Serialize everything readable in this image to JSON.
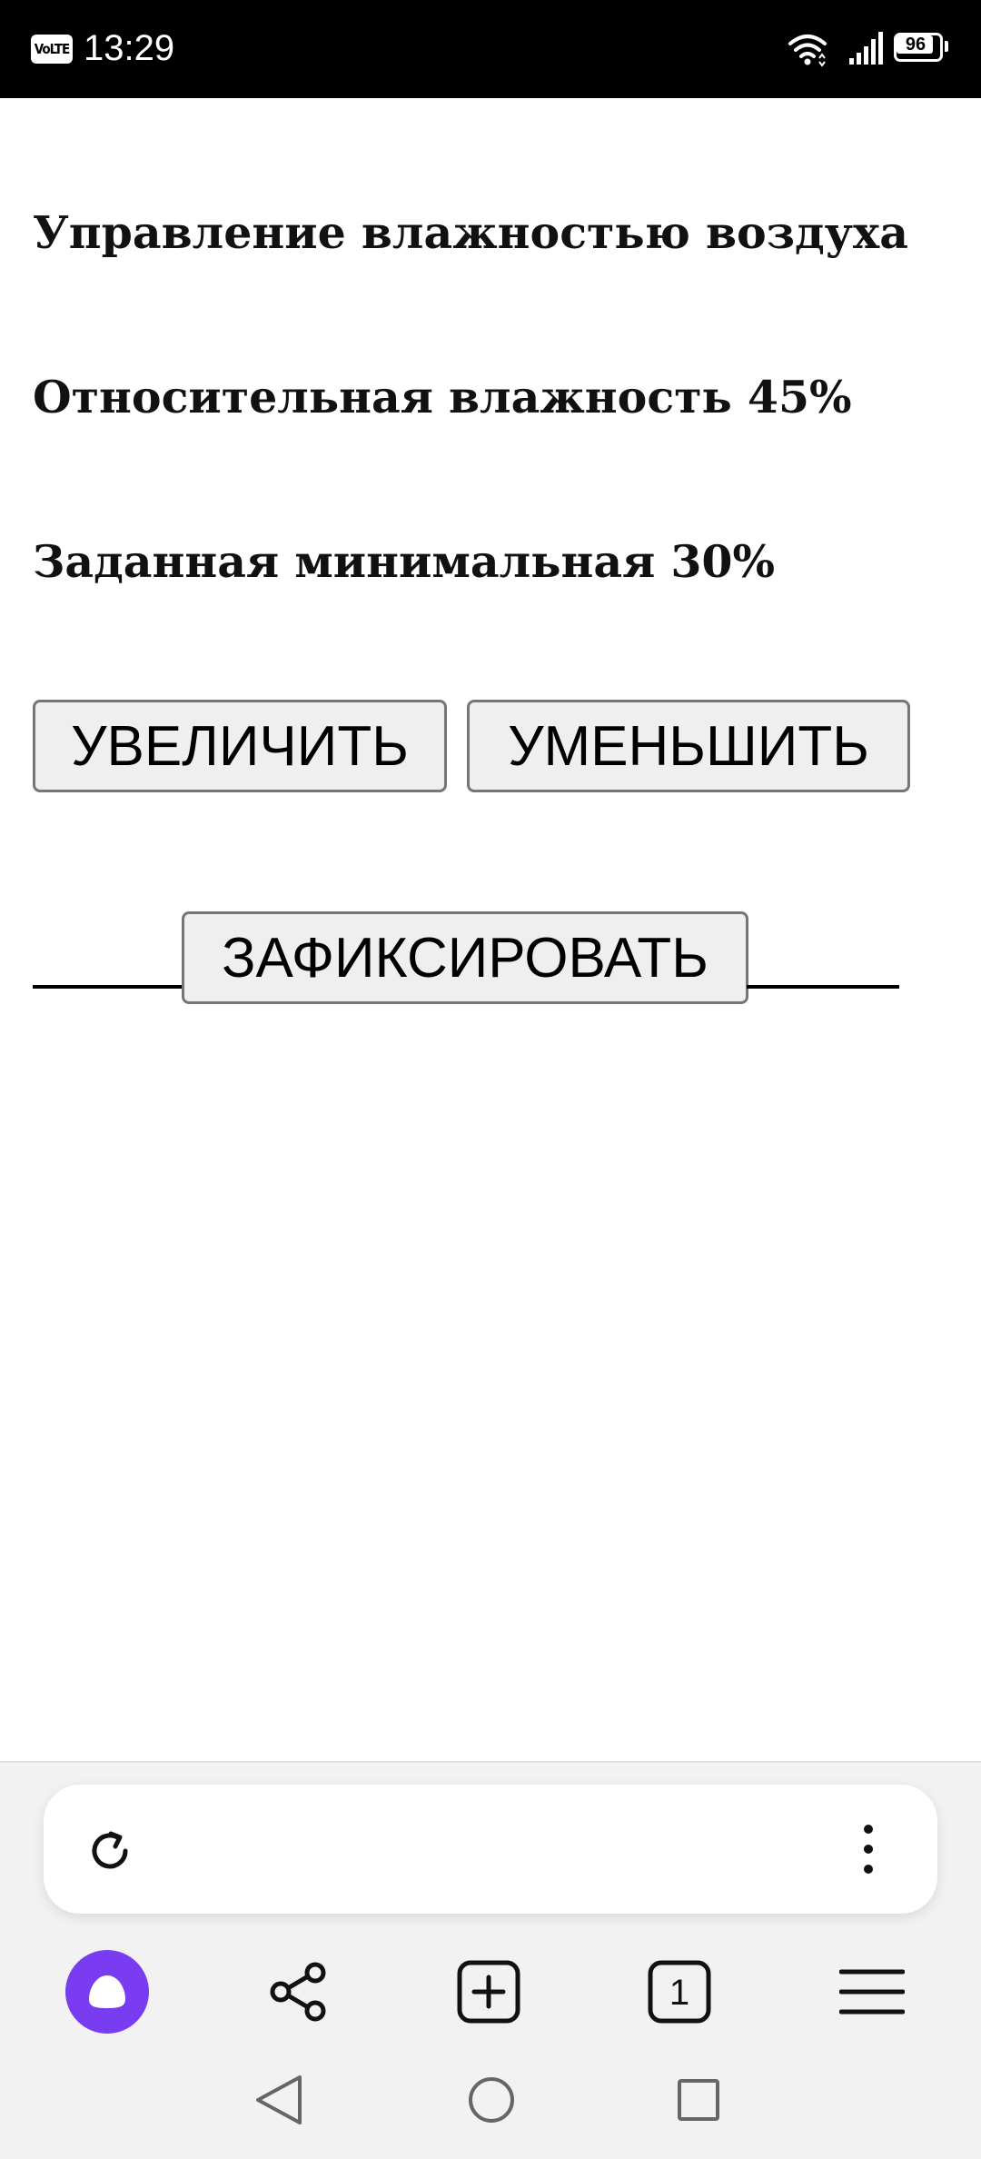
{
  "status_bar": {
    "network_badge": "VoLTE",
    "time": "13:29",
    "battery": "96",
    "battery_level_percent": 96
  },
  "content": {
    "title": "Управление влажностью воздуха",
    "humidity_text": "Относительная влажность 45%",
    "min_text": "Заданная минимальная 30%",
    "buttons": {
      "increase": "УВЕЛИЧИТЬ",
      "decrease": "УМЕНЬШИТЬ",
      "fix": "ЗАФИКСИРОВАТЬ"
    }
  },
  "browser": {
    "address_text": "",
    "nav": [
      "alice-icon",
      "share-icon",
      "new-tab-icon",
      "tabs-count-icon",
      "menu-icon"
    ],
    "tabs_count": "1",
    "accent_color": "#7a3cf0"
  },
  "system_nav": [
    "back-icon",
    "home-icon",
    "recent-apps-icon"
  ]
}
